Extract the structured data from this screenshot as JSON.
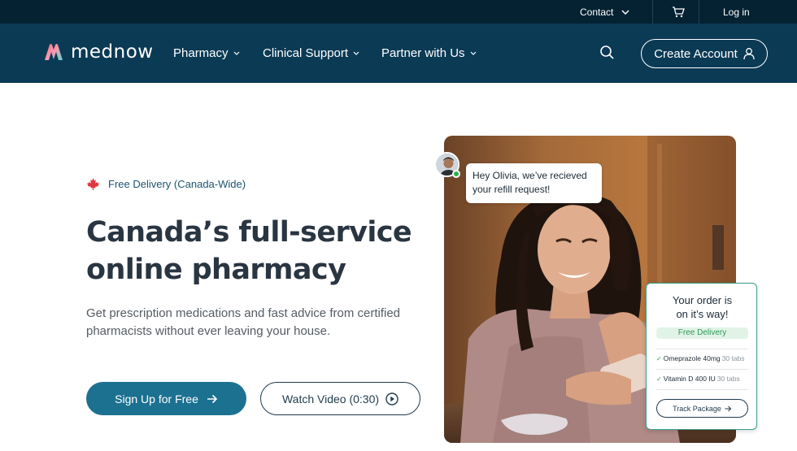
{
  "topbar": {
    "contact": "Contact",
    "login": "Log in"
  },
  "nav": {
    "logo_text": "mednow",
    "links": [
      "Pharmacy",
      "Clinical Support",
      "Partner with Us"
    ],
    "create_account": "Create Account"
  },
  "hero": {
    "badge": "Free Delivery (Canada-Wide)",
    "headline_line1": "Canada’s full-service",
    "headline_line2": "online pharmacy",
    "subtext_line1": "Get prescription medications and fast advice from certified",
    "subtext_line2": "pharmacists without ever leaving your house.",
    "primary_button": "Sign Up for Free",
    "video_button": "Watch Video (0:30)"
  },
  "chat": {
    "line1": "Hey Olivia, we’ve recieved",
    "line2": "your refill request!"
  },
  "order": {
    "title_line1": "Your order is",
    "title_line2": "on it’s way!",
    "pill": "Free Delivery",
    "items": [
      {
        "name": "Omeprazole 40mg",
        "qty": "30 tabs"
      },
      {
        "name": "Vitamin D 400 IU",
        "qty": "30 tabs"
      }
    ],
    "track_button": "Track Package"
  },
  "colors": {
    "topbar": "#052233",
    "nav": "#0b3a55",
    "primary": "#1c7191",
    "headline": "#2a3542",
    "success": "#2d9a56"
  },
  "icons": [
    "chevron-down-icon",
    "cart-icon",
    "search-icon",
    "user-icon",
    "maple-leaf-icon",
    "arrow-right-icon",
    "play-circle-icon",
    "check-icon"
  ]
}
